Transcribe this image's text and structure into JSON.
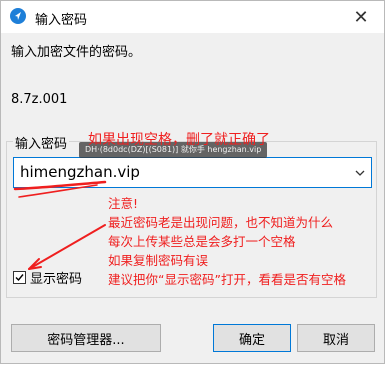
{
  "window": {
    "title": "输入密码",
    "close_glyph": "✕"
  },
  "dialog": {
    "prompt": "输入加密文件的密码。",
    "filename": "8.7z.001",
    "password_label": "输入密码",
    "password_value": "himengzhan.vip",
    "show_password_label": "显示密码",
    "show_password_checked": true
  },
  "buttons": {
    "manager": "密码管理器...",
    "ok": "确定",
    "cancel": "取消"
  },
  "tooltip": {
    "text": "DH·(8d0dc(DZ)[(S081)] 就你手 hengzhan.vip"
  },
  "annotation": {
    "top_note": "如果出现空格，删了就正确了",
    "lines": [
      "注意!",
      "最近密码老是出现问题，也不知道为什么",
      "每次上传某些总是会多打一个空格",
      "如果复制密码有误",
      "建议把你“显示密码”打开，看看是否有空格"
    ],
    "color": "#ef1f1f"
  },
  "icons": {
    "app": "app-logo-icon",
    "close": "close-icon",
    "dropdown": "chevron-down-icon",
    "check": "checkmark-icon"
  }
}
